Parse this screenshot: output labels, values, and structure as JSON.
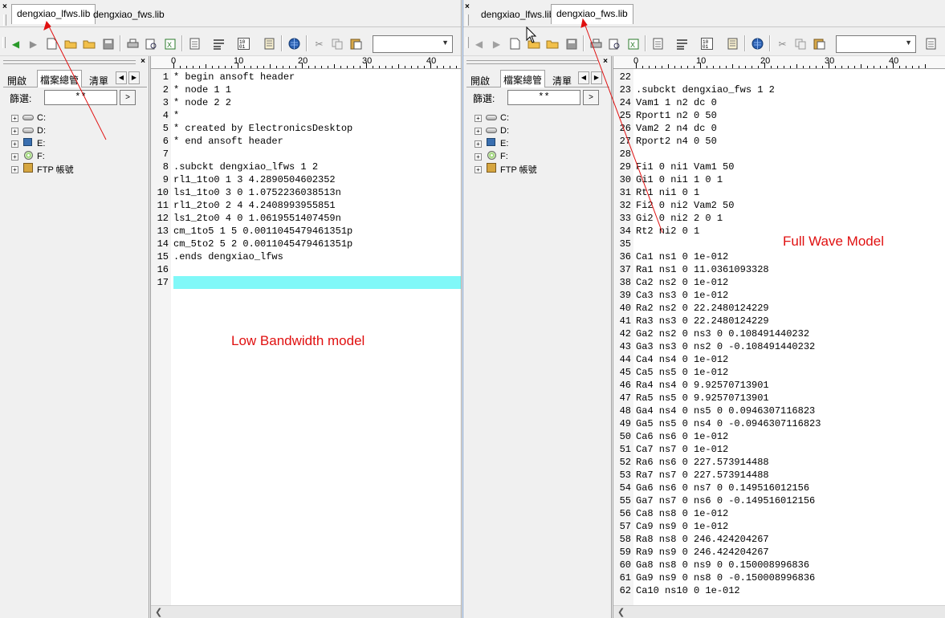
{
  "left_window": {
    "tabs": [
      {
        "label": "dengxiao_lfws.lib",
        "active": true
      },
      {
        "label": "dengxiao_fws.lib",
        "active": false
      }
    ],
    "panel": {
      "tabs": [
        "開啟",
        "檔案總管",
        "清單"
      ],
      "active_tab": "檔案總管",
      "filter_label": "篩選:",
      "filter_value": "**",
      "filter_go": ">",
      "tree": [
        {
          "label": "C:",
          "icon": "hard-drive"
        },
        {
          "label": "D:",
          "icon": "hard-drive"
        },
        {
          "label": "E:",
          "icon": "network-drive"
        },
        {
          "label": "F:",
          "icon": "cd-drive"
        },
        {
          "label": "FTP 帳號",
          "icon": "ftp"
        }
      ]
    },
    "ruler": [
      "0",
      "10",
      "20",
      "30",
      "40"
    ],
    "editor_lines": [
      {
        "n": "1",
        "text": "* begin ansoft header"
      },
      {
        "n": "2",
        "text": "* node 1 1"
      },
      {
        "n": "3",
        "text": "* node 2 2"
      },
      {
        "n": "4",
        "text": "*"
      },
      {
        "n": "5",
        "text": "* created by ElectronicsDesktop"
      },
      {
        "n": "6",
        "text": "* end ansoft header"
      },
      {
        "n": "7",
        "text": ""
      },
      {
        "n": "8",
        "text": ".subckt dengxiao_lfws 1 2"
      },
      {
        "n": "9",
        "text": "rl1_1to0 1 3 4.2890504602352"
      },
      {
        "n": "10",
        "text": "ls1_1to0 3 0 1.0752236038513n"
      },
      {
        "n": "11",
        "text": "rl1_2to0 2 4 4.2408993955851"
      },
      {
        "n": "12",
        "text": "ls1_2to0 4 0 1.0619551407459n"
      },
      {
        "n": "13",
        "text": "cm_1to5 1 5 0.0011045479461351p"
      },
      {
        "n": "14",
        "text": "cm_5to2 5 2 0.0011045479461351p"
      },
      {
        "n": "15",
        "text": ".ends dengxiao_lfws"
      },
      {
        "n": "16",
        "text": ""
      },
      {
        "n": "17",
        "text": ""
      }
    ],
    "highlight_line": "17"
  },
  "right_window": {
    "tabs": [
      {
        "label": "dengxiao_lfws.lib",
        "active": false
      },
      {
        "label": "dengxiao_fws.lib",
        "active": true
      }
    ],
    "panel": {
      "tabs": [
        "開啟",
        "檔案總管",
        "清單"
      ],
      "active_tab": "檔案總管",
      "filter_label": "篩選:",
      "filter_value": "**",
      "filter_go": ">",
      "tree": [
        {
          "label": "C:",
          "icon": "hard-drive"
        },
        {
          "label": "D:",
          "icon": "hard-drive"
        },
        {
          "label": "E:",
          "icon": "network-drive"
        },
        {
          "label": "F:",
          "icon": "cd-drive"
        },
        {
          "label": "FTP 帳號",
          "icon": "ftp"
        }
      ]
    },
    "ruler": [
      "0",
      "10",
      "20",
      "30",
      "40"
    ],
    "editor_lines": [
      {
        "n": "22",
        "text": ""
      },
      {
        "n": "23",
        "text": ".subckt dengxiao_fws 1 2"
      },
      {
        "n": "24",
        "text": "Vam1 1 n2 dc 0"
      },
      {
        "n": "25",
        "text": "Rport1 n2 0 50"
      },
      {
        "n": "26",
        "text": "Vam2 2 n4 dc 0"
      },
      {
        "n": "27",
        "text": "Rport2 n4 0 50"
      },
      {
        "n": "28",
        "text": ""
      },
      {
        "n": "29",
        "text": "Fi1 0 ni1 Vam1 50"
      },
      {
        "n": "30",
        "text": "Gi1 0 ni1 1 0 1"
      },
      {
        "n": "31",
        "text": "Rt1 ni1 0 1"
      },
      {
        "n": "32",
        "text": "Fi2 0 ni2 Vam2 50"
      },
      {
        "n": "33",
        "text": "Gi2 0 ni2 2 0 1"
      },
      {
        "n": "34",
        "text": "Rt2 ni2 0 1"
      },
      {
        "n": "35",
        "text": ""
      },
      {
        "n": "36",
        "text": "Ca1 ns1 0 1e-012"
      },
      {
        "n": "37",
        "text": "Ra1 ns1 0 11.0361093328"
      },
      {
        "n": "38",
        "text": "Ca2 ns2 0 1e-012"
      },
      {
        "n": "39",
        "text": "Ca3 ns3 0 1e-012"
      },
      {
        "n": "40",
        "text": "Ra2 ns2 0 22.2480124229"
      },
      {
        "n": "41",
        "text": "Ra3 ns3 0 22.2480124229"
      },
      {
        "n": "42",
        "text": "Ga2 ns2 0 ns3 0 0.108491440232"
      },
      {
        "n": "43",
        "text": "Ga3 ns3 0 ns2 0 -0.108491440232"
      },
      {
        "n": "44",
        "text": "Ca4 ns4 0 1e-012"
      },
      {
        "n": "45",
        "text": "Ca5 ns5 0 1e-012"
      },
      {
        "n": "46",
        "text": "Ra4 ns4 0 9.92570713901"
      },
      {
        "n": "47",
        "text": "Ra5 ns5 0 9.92570713901"
      },
      {
        "n": "48",
        "text": "Ga4 ns4 0 ns5 0 0.0946307116823"
      },
      {
        "n": "49",
        "text": "Ga5 ns5 0 ns4 0 -0.0946307116823"
      },
      {
        "n": "50",
        "text": "Ca6 ns6 0 1e-012"
      },
      {
        "n": "51",
        "text": "Ca7 ns7 0 1e-012"
      },
      {
        "n": "52",
        "text": "Ra6 ns6 0 227.573914488"
      },
      {
        "n": "53",
        "text": "Ra7 ns7 0 227.573914488"
      },
      {
        "n": "54",
        "text": "Ga6 ns6 0 ns7 0 0.149516012156"
      },
      {
        "n": "55",
        "text": "Ga7 ns7 0 ns6 0 -0.149516012156"
      },
      {
        "n": "56",
        "text": "Ca8 ns8 0 1e-012"
      },
      {
        "n": "57",
        "text": "Ca9 ns9 0 1e-012"
      },
      {
        "n": "58",
        "text": "Ra8 ns8 0 246.424204267"
      },
      {
        "n": "59",
        "text": "Ra9 ns9 0 246.424204267"
      },
      {
        "n": "60",
        "text": "Ga8 ns8 0 ns9 0 0.150008996836"
      },
      {
        "n": "61",
        "text": "Ga9 ns9 0 ns8 0 -0.150008996836"
      },
      {
        "n": "62",
        "text": "Ca10 ns10 0 1e-012"
      }
    ]
  },
  "annotations": {
    "left_label": "Low Bandwidth model",
    "right_label": "Full Wave Model",
    "color": "#e01010"
  },
  "icons": {
    "toolbar": [
      "back-arrow-icon",
      "forward-arrow-icon",
      "new-file-icon",
      "open-folder-icon",
      "open-folder-alt-icon",
      "save-icon",
      "print-icon",
      "print-preview-icon",
      "excel-icon",
      "page-icon",
      "wrap-icon",
      "binary-icon",
      "document-icon",
      "globe-icon",
      "cut-icon",
      "copy-icon",
      "paste-icon"
    ]
  }
}
